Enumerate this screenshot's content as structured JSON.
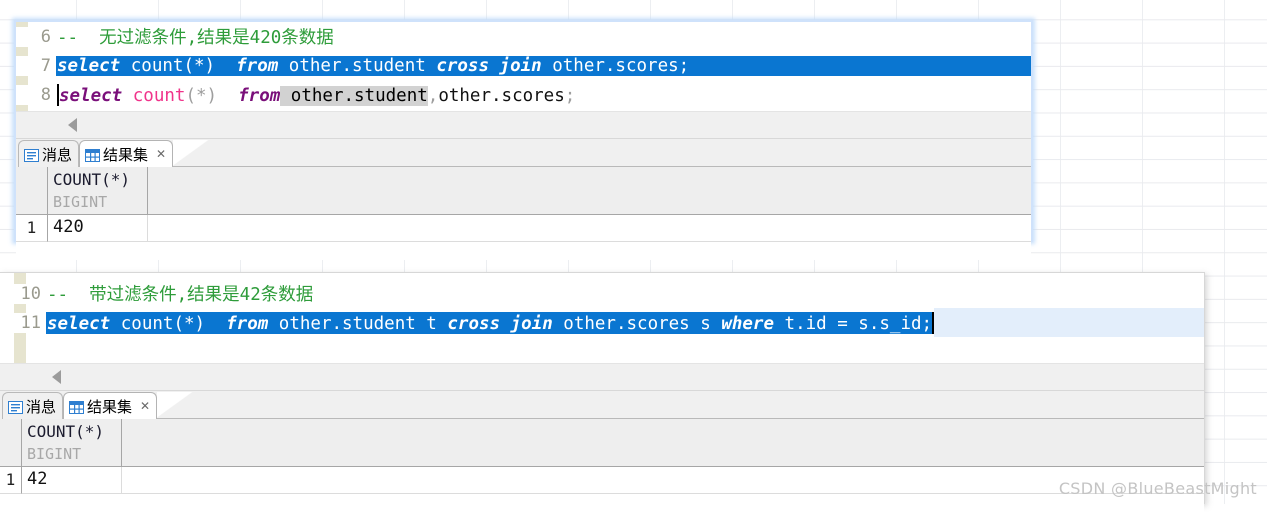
{
  "background": {
    "grid_color": "#eceef1"
  },
  "watermark": {
    "text": "CSDN @BlueBeastMight"
  },
  "colors": {
    "selection": "#0a76d1",
    "keyword": "#7a0f7a",
    "comment": "#2e9c3a",
    "function": "#f0338a",
    "tab_icon_blue": "#2f7fd0"
  },
  "panel_top": {
    "editor": {
      "lines": [
        {
          "number": "6",
          "type": "comment",
          "text": "--  无过滤条件,结果是420条数据"
        },
        {
          "number": "7",
          "type": "sql_selected",
          "text": "select count(*)  from other.student cross join other.scores;",
          "tokens": {
            "kw1": "select",
            "fn": " count",
            "paren": "(*)",
            "kw2": "  from",
            "t1": " other.student ",
            "kw3": "cross join",
            "t2": " other.scores;"
          }
        },
        {
          "number": "8",
          "type": "sql",
          "text": "select count(*)  from other.student,other.scores;",
          "tokens": {
            "kw1": "select",
            "fn": " count",
            "paren": "(*)",
            "kw2": "  from",
            "t1": " other.student",
            "comma": ",",
            "t2": "other.scores",
            "semi": ";"
          }
        }
      ]
    },
    "scrollbar": {
      "left_arrow": "scroll-left-arrow"
    },
    "tabs": [
      {
        "label": "消息",
        "icon": "message-icon",
        "active": false,
        "closable": false
      },
      {
        "label": "结果集",
        "icon": "result-grid-icon",
        "active": true,
        "closable": true,
        "close_glyph": "✕"
      }
    ],
    "result_grid": {
      "column_name": "COUNT(*)",
      "column_type": "BIGINT",
      "rows": [
        {
          "num": "1",
          "value": "420"
        }
      ]
    }
  },
  "panel_bottom": {
    "editor": {
      "lines": [
        {
          "number": "10",
          "type": "comment",
          "text": "--  带过滤条件,结果是42条数据"
        },
        {
          "number": "11",
          "type": "sql_selected",
          "text": "select count(*)  from other.student t cross join other.scores s where t.id = s.s_id;",
          "tokens": {
            "kw1": "select",
            "fn": " count",
            "paren": "(*)",
            "kw2": "  from",
            "t1": " other.student t ",
            "kw3": "cross join",
            "t2": " other.scores s ",
            "kw4": "where",
            "t3": " t.id = s.s_id;"
          }
        }
      ]
    },
    "scrollbar": {
      "left_arrow": "scroll-left-arrow"
    },
    "tabs": [
      {
        "label": "消息",
        "icon": "message-icon",
        "active": false,
        "closable": false
      },
      {
        "label": "结果集",
        "icon": "result-grid-icon",
        "active": true,
        "closable": true,
        "close_glyph": "✕"
      }
    ],
    "result_grid": {
      "column_name": "COUNT(*)",
      "column_type": "BIGINT",
      "rows": [
        {
          "num": "1",
          "value": "42"
        }
      ]
    }
  }
}
